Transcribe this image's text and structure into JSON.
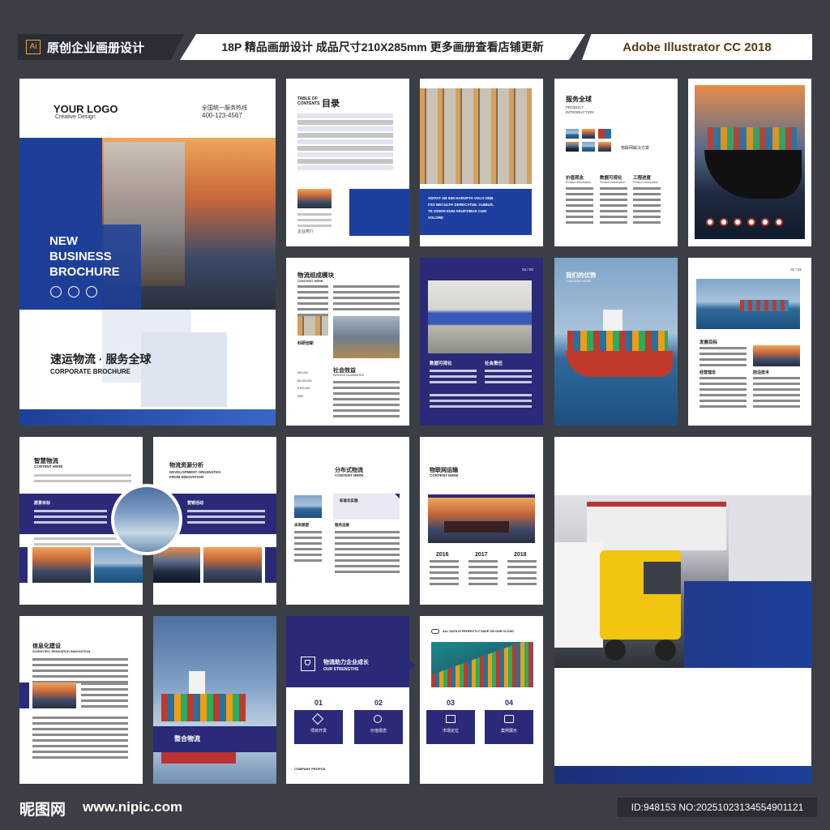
{
  "header": {
    "ai_badge": "Ai",
    "left_title": "原创企业画册设计",
    "center_title": "18P 精品画册设计 成品尺寸210X285mm 更多画册查看店铺更新",
    "right_title": "Adobe Illustrator CC 2018"
  },
  "cover": {
    "logo": "YOUR LOGO",
    "logo_sub": "Creative Design",
    "hotline_label": "全国统一服务热线",
    "hotline": "400-123-4567",
    "headline_1": "NEW",
    "headline_2": "BUSINESS",
    "headline_3": "BROCHURE",
    "cn_title": "速运物流 · 服务全球",
    "en_sub": "CORPORATE BROCHURE"
  },
  "toc": {
    "label_en_1": "TABLE OF",
    "label_en_2": "CONTENTS",
    "title": "目录",
    "caption": "企业简介"
  },
  "warehouse": {
    "caption_1": "ADITAT AB IUM HARUPTA VOLO DEB",
    "caption_2": "ITIO NECULPA DERECATUE. AUIBUS,",
    "caption_3": "TE ODION EUM ARUPTIBUS CUM",
    "caption_4": "VOLORE"
  },
  "services": {
    "title": "服务全球",
    "sub_1": "PRODUCT",
    "sub_2": "INTRODUCTION",
    "iot": "物联网解决方案",
    "col_1": "价值观念",
    "col_2": "数据可视化",
    "col_3": "工程进度",
    "col_sub": "Product introduction"
  },
  "modules": {
    "title": "物流组成模块",
    "sub": "CONTENT HERE",
    "innovation": "科研创新",
    "benefit": "社会效益",
    "benefit_sub": "SERVICE GUARANTEE",
    "stats": [
      "800,000",
      "86,000,000",
      "5,800,000",
      "95%"
    ]
  },
  "navy_page": {
    "page_no": "01 / 02",
    "label_1": "数据可视化",
    "label_2": "社会责任"
  },
  "advantage": {
    "title": "我们的优势",
    "sub": "CONTENT HERE"
  },
  "development": {
    "page_no": "01 / 02",
    "goal": "发展目标",
    "col_1": "经营理念",
    "col_2": "前沿技术"
  },
  "smart": {
    "title": "智慧物流",
    "sub": "CONTENT HERE",
    "band": "愿景目标"
  },
  "resources": {
    "title": "物流资源分析",
    "sub_1": "DEVELOPMENT ORIGINATES",
    "sub_2": "FROM INNOVATION",
    "band": "营销活动"
  },
  "distributed": {
    "title": "分布式物流",
    "sub": "CONTENT HERE",
    "std": "标准化实施",
    "future": "未来展望",
    "ops": "服务运维"
  },
  "iot_transport": {
    "title": "物联网运输",
    "sub": "CONTENT HERE",
    "years": [
      "2016",
      "2017",
      "2018"
    ]
  },
  "informatization": {
    "title": "信息化建设",
    "sub": "SCIENTIFIC RESEARCH INNOVATION"
  },
  "integration": {
    "label": "整合物流"
  },
  "strengths": {
    "title": "物流助力企业成长",
    "sub": "OUR STRENGTHS",
    "company": "COMPANY PROPOS",
    "cloud": "ALL DATA IS PERFECTLY SAVE ON OUR CLOUD",
    "items": [
      {
        "no": "01",
        "label": "项目开发"
      },
      {
        "no": "02",
        "label": "价值观念"
      },
      {
        "no": "03",
        "label": "市场定位"
      },
      {
        "no": "04",
        "label": "案例展示"
      }
    ]
  },
  "footer": {
    "brand": "昵图网",
    "url": "www.nipic.com",
    "id": "ID:948153 NO:20251023134554901121"
  }
}
